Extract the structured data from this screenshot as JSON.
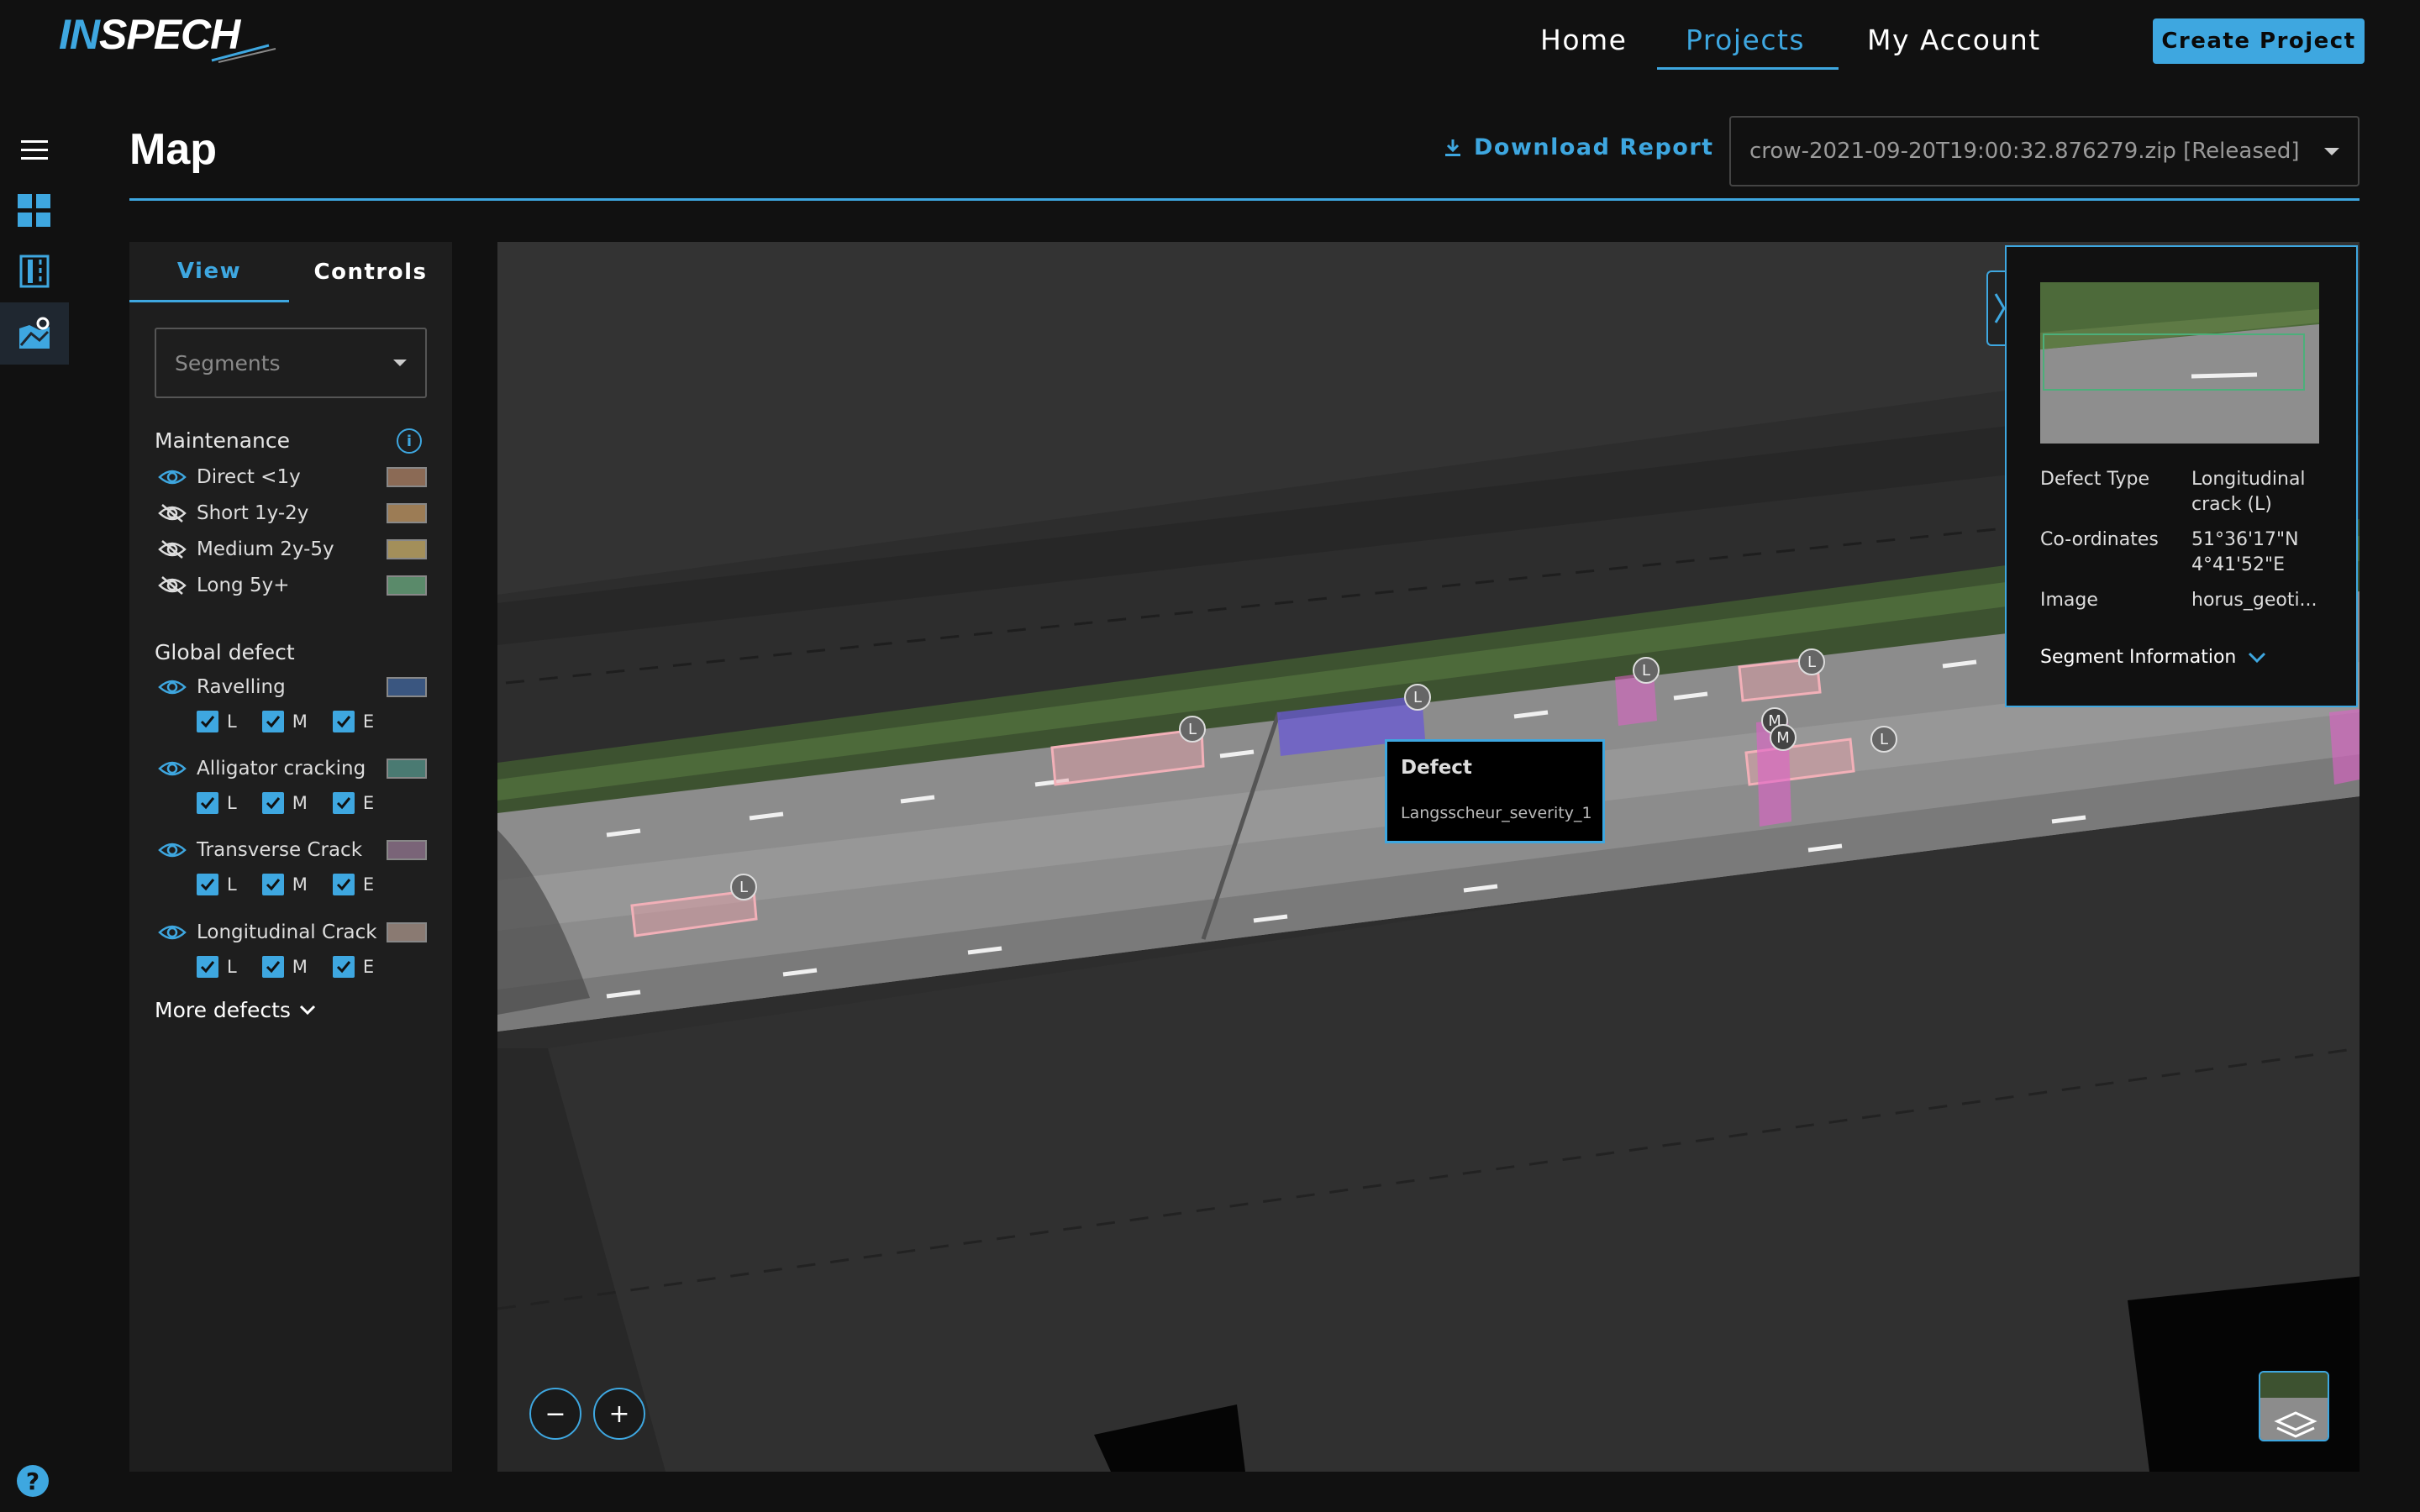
{
  "brand": {
    "logo_in": "IN",
    "logo_rest": "SPECH"
  },
  "nav": {
    "home": "Home",
    "projects": "Projects",
    "account": "My Account",
    "create": "Create Project"
  },
  "page": {
    "title": "Map",
    "download": "Download Report",
    "file": "crow-2021-09-20T19:00:32.876279.zip [Released]"
  },
  "panel": {
    "tabs": {
      "view": "View",
      "controls": "Controls"
    },
    "segments_placeholder": "Segments",
    "maintenance_title": "Maintenance",
    "maintenance": [
      {
        "label": "Direct <1y",
        "visible": true,
        "color": "#8b6a55"
      },
      {
        "label": "Short 1y-2y",
        "visible": false,
        "color": "#9c7c55"
      },
      {
        "label": "Medium 2y-5y",
        "visible": false,
        "color": "#a38f5a"
      },
      {
        "label": "Long 5y+",
        "visible": false,
        "color": "#5a8a6a"
      }
    ],
    "global_title": "Global defect",
    "defects": [
      {
        "label": "Ravelling",
        "color": "#3a5680"
      },
      {
        "label": "Alligator cracking",
        "color": "#4a7a72"
      },
      {
        "label": "Transverse Crack",
        "color": "#7a6478"
      },
      {
        "label": "Longitudinal Crack",
        "color": "#8a7a72"
      }
    ],
    "checks": {
      "l": "L",
      "m": "M",
      "e": "E"
    },
    "more": "More defects"
  },
  "map": {
    "tooltip_title": "Defect",
    "tooltip_value": "Langsscheur_severity_1",
    "zoom_out": "−",
    "zoom_in": "+",
    "markers": {
      "l": "L",
      "m": "M"
    }
  },
  "card": {
    "defect_type_key": "Defect Type",
    "defect_type_val_1": "Longitudinal",
    "defect_type_val_2": "crack (L)",
    "coord_key": "Co-ordinates",
    "coord_val_1": "51°36'17\"N",
    "coord_val_2": "4°41'52\"E",
    "image_key": "Image",
    "image_val": "horus_geoti...",
    "segment_info": "Segment Information"
  },
  "colors": {
    "accent": "#3ea7e0",
    "background": "#111111",
    "panel": "#1e1e1e",
    "map": "#2d2d2d"
  }
}
